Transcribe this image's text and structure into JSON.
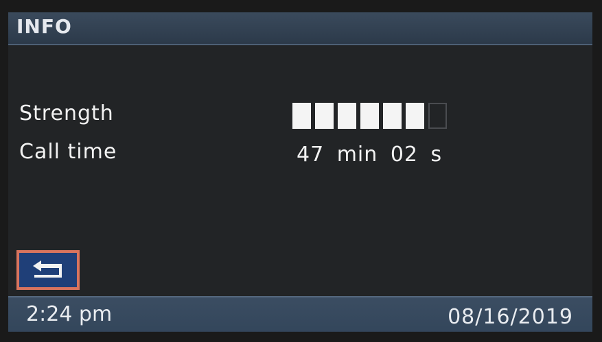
{
  "header": {
    "title": "INFO"
  },
  "rows": {
    "strength": {
      "label": "Strength",
      "bars_filled": 6,
      "bars_total": 7
    },
    "call_time": {
      "label": "Call time",
      "value": "47 min 02 s"
    }
  },
  "back_button": {
    "icon": "return-arrow-icon"
  },
  "status_bar": {
    "time": "2:24 pm",
    "date": "08/16/2019"
  },
  "colors": {
    "title_bar": "#33465b",
    "back_button_fill": "#1f3f78",
    "back_button_border": "#d9745e",
    "text": "#f2f2f2"
  }
}
